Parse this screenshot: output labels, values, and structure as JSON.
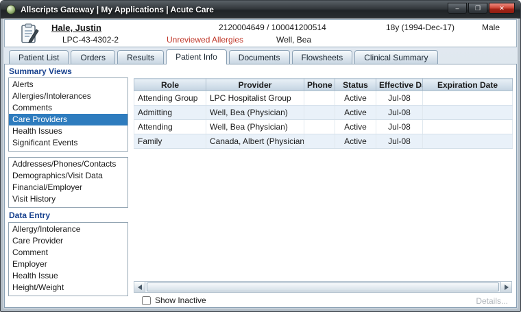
{
  "window": {
    "title": "Allscripts Gateway | My Applications | Acute Care",
    "controls": {
      "minimize": "–",
      "maximize": "❐",
      "close": "✕"
    }
  },
  "banner": {
    "name": "Hale, Justin",
    "patient_id": "LPC-43-4302-2",
    "account": "2120004649 / 100041200514",
    "allergy_alert": "Unreviewed Allergies",
    "attending_provider": "Well, Bea",
    "age_dob": "18y (1994-Dec-17)",
    "sex": "Male"
  },
  "tabs": [
    {
      "label": "Patient List"
    },
    {
      "label": "Orders"
    },
    {
      "label": "Results"
    },
    {
      "label": "Patient Info"
    },
    {
      "label": "Documents"
    },
    {
      "label": "Flowsheets"
    },
    {
      "label": "Clinical Summary"
    }
  ],
  "sidebar": {
    "summary_views_label": "Summary Views",
    "summary_items": [
      "Alerts",
      "Allergies/Intolerances",
      "Comments",
      "Care Providers",
      "Health Issues",
      "Significant Events"
    ],
    "info_items": [
      "Addresses/Phones/Contacts",
      "Demographics/Visit Data",
      "Financial/Employer",
      "Visit History"
    ],
    "data_entry_label": "Data Entry",
    "entry_items": [
      "Allergy/Intolerance",
      "Care Provider",
      "Comment",
      "Employer",
      "Health Issue",
      "Height/Weight"
    ]
  },
  "table": {
    "columns": [
      "Role",
      "Provider",
      "Phone",
      "Status",
      "Effective Date",
      "Expiration Date"
    ],
    "rows": [
      [
        "Attending Group",
        "LPC Hospitalist Group",
        "",
        "Active",
        "Jul-08",
        ""
      ],
      [
        "Admitting",
        "Well, Bea (Physician)",
        "",
        "Active",
        "Jul-08",
        ""
      ],
      [
        "Attending",
        "Well, Bea (Physician)",
        "",
        "Active",
        "Jul-08",
        ""
      ],
      [
        "Family",
        "Canada, Albert (Physician)",
        "",
        "Active",
        "Jul-08",
        ""
      ]
    ]
  },
  "footer": {
    "show_inactive_label": "Show Inactive",
    "details_label": "Details..."
  },
  "colors": {
    "selection_blue": "#2e7cbe",
    "alert_red": "#c0392b",
    "section_label_blue": "#17418e"
  }
}
